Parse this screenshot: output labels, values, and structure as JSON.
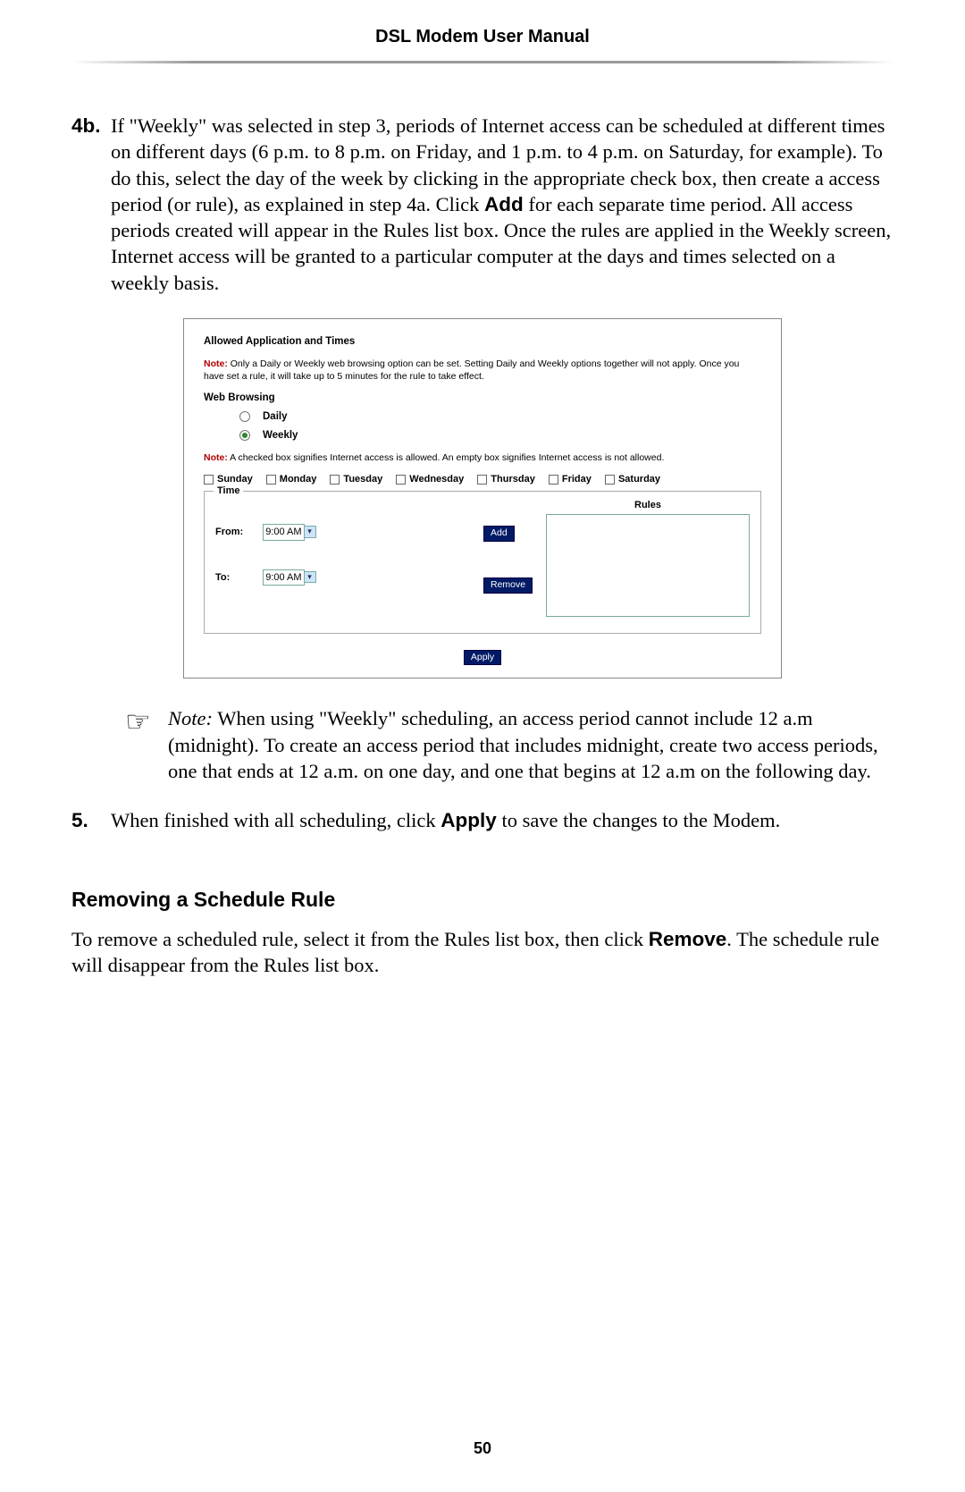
{
  "header": {
    "title": "DSL Modem User Manual"
  },
  "step4b": {
    "num": "4b.",
    "text_before_add": "If \"Weekly\" was selected in step 3, periods of Internet access can be scheduled at different times on different days (6 p.m. to 8 p.m. on Friday, and 1 p.m. to 4 p.m. on Saturday, for example). To do this, select the day of the week by clicking in the appropriate check box, then create a access period (or rule), as explained in step 4a. Click ",
    "add_word": "Add",
    "text_after_add": " for each separate time period. All access periods created will appear in the Rules list box. Once the rules are applied in the Weekly screen, Internet access will be granted to a particular computer at the days and times selected on a weekly basis."
  },
  "ui": {
    "section_title": "Allowed Application and Times",
    "note1": {
      "label": "Note:",
      "text": " Only a Daily or Weekly web browsing option can be set. Setting Daily and Weekly options together will not apply. Once you have set a rule, it will take up to 5 minutes for the rule to take effect."
    },
    "web_browsing_label": "Web Browsing",
    "radio": {
      "daily": "Daily",
      "weekly": "Weekly",
      "selected": "weekly"
    },
    "note2": {
      "label": "Note:",
      "text": " A checked box signifies Internet access is allowed. An empty box signifies Internet access is not allowed."
    },
    "days": [
      "Sunday",
      "Monday",
      "Tuesday",
      "Wednesday",
      "Thursday",
      "Friday",
      "Saturday"
    ],
    "time_legend": "Time",
    "from_label": "From:",
    "to_label": "To:",
    "from_value": "9:00 AM",
    "to_value": "9:00 AM",
    "add_btn": "Add",
    "remove_btn": "Remove",
    "rules_title": "Rules",
    "apply_btn": "Apply"
  },
  "note_block": {
    "label": "Note:",
    "text": " When using \"Weekly\" scheduling, an access period cannot include 12 a.m (midnight). To create an access period that includes midnight, create two access periods, one that ends at 12 a.m. on one day, and one that begins at 12 a.m on the following day."
  },
  "step5": {
    "num": "5.",
    "before": "When finished with all scheduling, click ",
    "apply_word": "Apply",
    "after": " to save the changes to the Modem."
  },
  "removing": {
    "heading": "Removing a Schedule Rule",
    "para_before": "To remove a scheduled rule, select it from the Rules list box, then click ",
    "remove_word": "Remove",
    "para_after": ". The schedule rule will disappear from the Rules list box."
  },
  "page_number": "50"
}
